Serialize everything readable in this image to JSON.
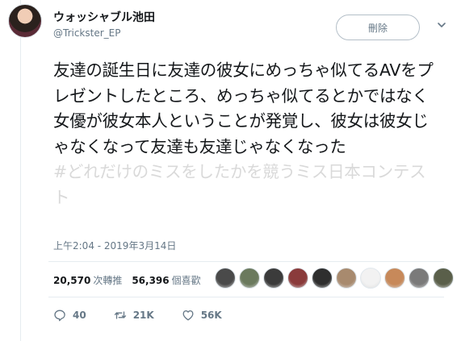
{
  "header": {
    "display_name": "ウォッシャブル池田",
    "handle": "@Trickster_EP",
    "action_button_label": "刪除"
  },
  "tweet": {
    "text": "友達の誕生日に友達の彼女にめっちゃ似てるAVをプレゼントしたところ、めっちゃ似てるとかではなく女優が彼女本人ということが発覚し、彼女は彼女じゃなくなって友達も友達じゃなくなった",
    "hashtag": "#どれだけのミスをしたかを競うミス日本コンテスト",
    "timestamp": "上午2:04 - 2019年3月14日"
  },
  "stats": {
    "retweets_count": "20,570",
    "retweets_label": "次轉推",
    "likes_count": "56,396",
    "likes_label": "個喜歡"
  },
  "likers": [
    {
      "icon": "liker-avatar-1",
      "color": "#4a4a4a"
    },
    {
      "icon": "liker-avatar-2",
      "color": "#6b7a5e"
    },
    {
      "icon": "liker-avatar-3",
      "color": "#3b3b3b"
    },
    {
      "icon": "liker-avatar-4",
      "color": "#8a3b3b"
    },
    {
      "icon": "liker-avatar-5",
      "color": "#2e2e2e"
    },
    {
      "icon": "liker-avatar-6",
      "color": "#a88a6e"
    },
    {
      "icon": "liker-avatar-7",
      "color": "#f2f2f2"
    },
    {
      "icon": "liker-avatar-8",
      "color": "#c7895a"
    },
    {
      "icon": "liker-avatar-9",
      "color": "#7a7a7a"
    },
    {
      "icon": "liker-avatar-10",
      "color": "#5a5f4a"
    }
  ],
  "actions": {
    "reply_count": "40",
    "retweet_count": "21K",
    "like_count": "56K"
  },
  "colors": {
    "text": "#14171a",
    "secondary": "#657786",
    "hashtag": "#d9d9d9",
    "divider": "#e6ecf0"
  }
}
